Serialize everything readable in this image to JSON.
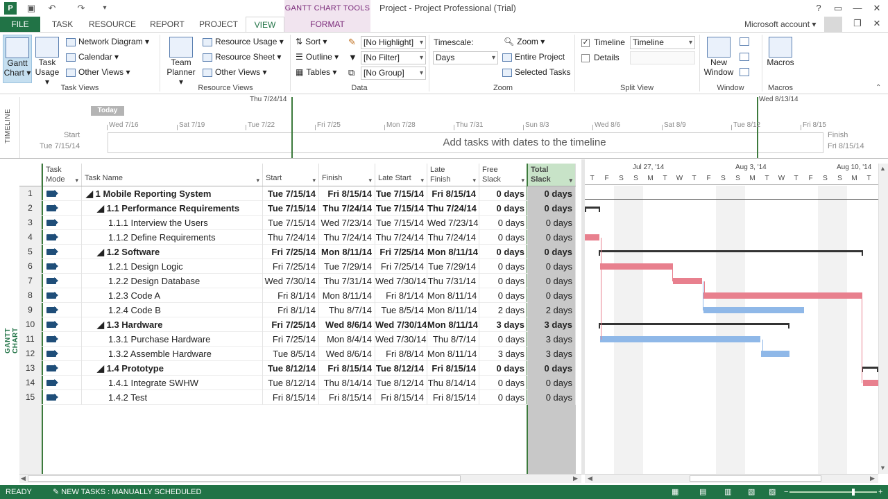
{
  "app": {
    "title": "Project - Project Professional (Trial)",
    "context_tab_header": "GANTT CHART TOOLS",
    "account": "Microsoft account"
  },
  "tabs": [
    "FILE",
    "TASK",
    "RESOURCE",
    "REPORT",
    "PROJECT",
    "VIEW",
    "FORMAT"
  ],
  "ribbon": {
    "task_views": {
      "gantt": "Gantt Chart",
      "gantt_l1": "Gantt",
      "gantt_l2": "Chart ▾",
      "usage_l1": "Task",
      "usage_l2": "Usage ▾",
      "network": "Network Diagram",
      "calendar": "Calendar",
      "other": "Other Views",
      "label": "Task Views"
    },
    "resource_views": {
      "planner_l1": "Team",
      "planner_l2": "Planner ▾",
      "usage": "Resource Usage",
      "sheet": "Resource Sheet",
      "other": "Other Views",
      "label": "Resource Views"
    },
    "data": {
      "sort": "Sort",
      "outline": "Outline",
      "tables": "Tables",
      "highlight": "[No Highlight]",
      "filter": "[No Filter]",
      "group": "[No Group]",
      "label": "Data"
    },
    "zoom": {
      "timescale_label": "Timescale:",
      "timescale": "Days",
      "zoom": "Zoom",
      "entire": "Entire Project",
      "selected": "Selected Tasks",
      "label": "Zoom"
    },
    "split": {
      "timeline": "Timeline",
      "timeline_value": "Timeline",
      "details": "Details",
      "label": "Split View"
    },
    "window": {
      "new_l1": "New",
      "new_l2": "Window",
      "label": "Window"
    },
    "macros": {
      "btn": "Macros",
      "label": "Macros"
    }
  },
  "timeline": {
    "side": "TIMELINE",
    "today": "Today",
    "start_label": "Start",
    "start_date": "Tue 7/15/14",
    "finish_label": "Finish",
    "finish_date": "Fri 8/15/14",
    "window_start": "Thu 7/24/14",
    "window_end": "Wed 8/13/14",
    "hint": "Add tasks with dates to the timeline",
    "ticks": [
      "Wed 7/16",
      "Sat 7/19",
      "Tue 7/22",
      "Fri 7/25",
      "Mon 7/28",
      "Thu 7/31",
      "Sun 8/3",
      "Wed 8/6",
      "Sat 8/9",
      "Tue 8/12",
      "Fri 8/15"
    ]
  },
  "grid": {
    "side_label": "GANTT CHART",
    "headers": {
      "mode": [
        "Task",
        "Mode"
      ],
      "name": "Task Name",
      "start": "Start",
      "finish": "Finish",
      "late_start": "Late Start",
      "late_finish": [
        "Late",
        "Finish"
      ],
      "free": [
        "Free",
        "Slack"
      ],
      "total": [
        "Total",
        "Slack"
      ]
    },
    "rows": [
      {
        "id": "1",
        "name": "◢ 1 Mobile Reporting System",
        "indent": 0,
        "bold": true,
        "start": "Tue 7/15/14",
        "finish": "Fri 8/15/14",
        "ls": "Tue 7/15/14",
        "lf": "Fri 8/15/14",
        "free": "0 days",
        "total": "0 days"
      },
      {
        "id": "2",
        "name": "◢ 1.1 Performance Requirements",
        "indent": 1,
        "bold": true,
        "start": "Tue 7/15/14",
        "finish": "Thu 7/24/14",
        "ls": "Tue 7/15/14",
        "lf": "Thu 7/24/14",
        "free": "0 days",
        "total": "0 days"
      },
      {
        "id": "3",
        "name": "1.1.1 Interview the Users",
        "indent": 2,
        "bold": false,
        "start": "Tue 7/15/14",
        "finish": "Wed 7/23/14",
        "ls": "Tue 7/15/14",
        "lf": "Wed 7/23/14",
        "free": "0 days",
        "total": "0 days"
      },
      {
        "id": "4",
        "name": "1.1.2 Define Requirements",
        "indent": 2,
        "bold": false,
        "start": "Thu 7/24/14",
        "finish": "Thu 7/24/14",
        "ls": "Thu 7/24/14",
        "lf": "Thu 7/24/14",
        "free": "0 days",
        "total": "0 days"
      },
      {
        "id": "5",
        "name": "◢ 1.2 Software",
        "indent": 1,
        "bold": true,
        "start": "Fri 7/25/14",
        "finish": "Mon 8/11/14",
        "ls": "Fri 7/25/14",
        "lf": "Mon 8/11/14",
        "free": "0 days",
        "total": "0 days"
      },
      {
        "id": "6",
        "name": "1.2.1 Design Logic",
        "indent": 2,
        "bold": false,
        "start": "Fri 7/25/14",
        "finish": "Tue 7/29/14",
        "ls": "Fri 7/25/14",
        "lf": "Tue 7/29/14",
        "free": "0 days",
        "total": "0 days"
      },
      {
        "id": "7",
        "name": "1.2.2 Design Database",
        "indent": 2,
        "bold": false,
        "start": "Wed 7/30/14",
        "finish": "Thu 7/31/14",
        "ls": "Wed 7/30/14",
        "lf": "Thu 7/31/14",
        "free": "0 days",
        "total": "0 days"
      },
      {
        "id": "8",
        "name": "1.2.3 Code A",
        "indent": 2,
        "bold": false,
        "start": "Fri 8/1/14",
        "finish": "Mon 8/11/14",
        "ls": "Fri 8/1/14",
        "lf": "Mon 8/11/14",
        "free": "0 days",
        "total": "0 days"
      },
      {
        "id": "9",
        "name": "1.2.4 Code B",
        "indent": 2,
        "bold": false,
        "start": "Fri 8/1/14",
        "finish": "Thu 8/7/14",
        "ls": "Tue 8/5/14",
        "lf": "Mon 8/11/14",
        "free": "2 days",
        "total": "2 days"
      },
      {
        "id": "10",
        "name": "◢ 1.3 Hardware",
        "indent": 1,
        "bold": true,
        "start": "Fri 7/25/14",
        "finish": "Wed 8/6/14",
        "ls": "Wed 7/30/14",
        "lf": "Mon 8/11/14",
        "free": "3 days",
        "total": "3 days"
      },
      {
        "id": "11",
        "name": "1.3.1 Purchase Hardware",
        "indent": 2,
        "bold": false,
        "start": "Fri 7/25/14",
        "finish": "Mon 8/4/14",
        "ls": "Wed 7/30/14",
        "lf": "Thu 8/7/14",
        "free": "0 days",
        "total": "3 days"
      },
      {
        "id": "12",
        "name": "1.3.2 Assemble Hardware",
        "indent": 2,
        "bold": false,
        "start": "Tue 8/5/14",
        "finish": "Wed 8/6/14",
        "ls": "Fri 8/8/14",
        "lf": "Mon 8/11/14",
        "free": "3 days",
        "total": "3 days"
      },
      {
        "id": "13",
        "name": "◢ 1.4 Prototype",
        "indent": 1,
        "bold": true,
        "start": "Tue 8/12/14",
        "finish": "Fri 8/15/14",
        "ls": "Tue 8/12/14",
        "lf": "Fri 8/15/14",
        "free": "0 days",
        "total": "0 days"
      },
      {
        "id": "14",
        "name": "1.4.1 Integrate SWHW",
        "indent": 2,
        "bold": false,
        "start": "Tue 8/12/14",
        "finish": "Thu 8/14/14",
        "ls": "Tue 8/12/14",
        "lf": "Thu 8/14/14",
        "free": "0 days",
        "total": "0 days"
      },
      {
        "id": "15",
        "name": "1.4.2 Test",
        "indent": 2,
        "bold": false,
        "start": "Fri 8/15/14",
        "finish": "Fri 8/15/14",
        "ls": "Fri 8/15/14",
        "lf": "Fri 8/15/14",
        "free": "0 days",
        "total": "0 days"
      }
    ]
  },
  "gantt": {
    "weeks": [
      "Jul 27, '14",
      "Aug 3, '14",
      "Aug 10, '14"
    ],
    "days": [
      "T",
      "F",
      "S",
      "S",
      "M",
      "T",
      "W",
      "T",
      "F",
      "S",
      "S",
      "M",
      "T",
      "W",
      "T",
      "F",
      "S",
      "S",
      "M",
      "T"
    ],
    "critical_color": "#e8808e",
    "noncritical_color": "#8fb8e8"
  },
  "status": {
    "ready": "READY",
    "new_tasks": "NEW TASKS : MANUALLY SCHEDULED"
  }
}
